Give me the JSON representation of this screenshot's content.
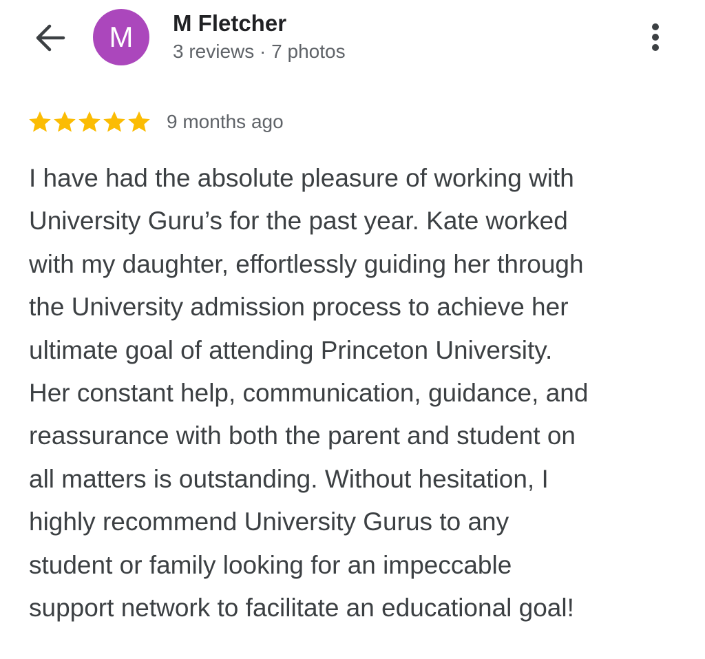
{
  "header": {
    "back_icon": "arrow-left-icon",
    "avatar_letter": "M",
    "avatar_color": "#ab47bc",
    "author_name": "M Fletcher",
    "author_meta": "3 reviews · 7 photos",
    "more_icon": "more-vertical-icon"
  },
  "review": {
    "rating": 5,
    "rating_max": 5,
    "star_color": "#fbbc04",
    "date": "9 months ago",
    "text_lines": [
      "I have had the absolute pleasure of working with",
      "University Guru’s for the past year. Kate worked",
      "with my daughter, effortlessly guiding her through",
      "the University admission process to achieve her",
      "ultimate goal of attending Princeton University.",
      "Her constant help, communication, guidance, and",
      "reassurance with both the parent and student on",
      "all matters is outstanding. Without hesitation, I",
      "highly recommend University Gurus to any",
      "student or family looking for an impeccable",
      "support network to facilitate an educational goal!"
    ]
  }
}
